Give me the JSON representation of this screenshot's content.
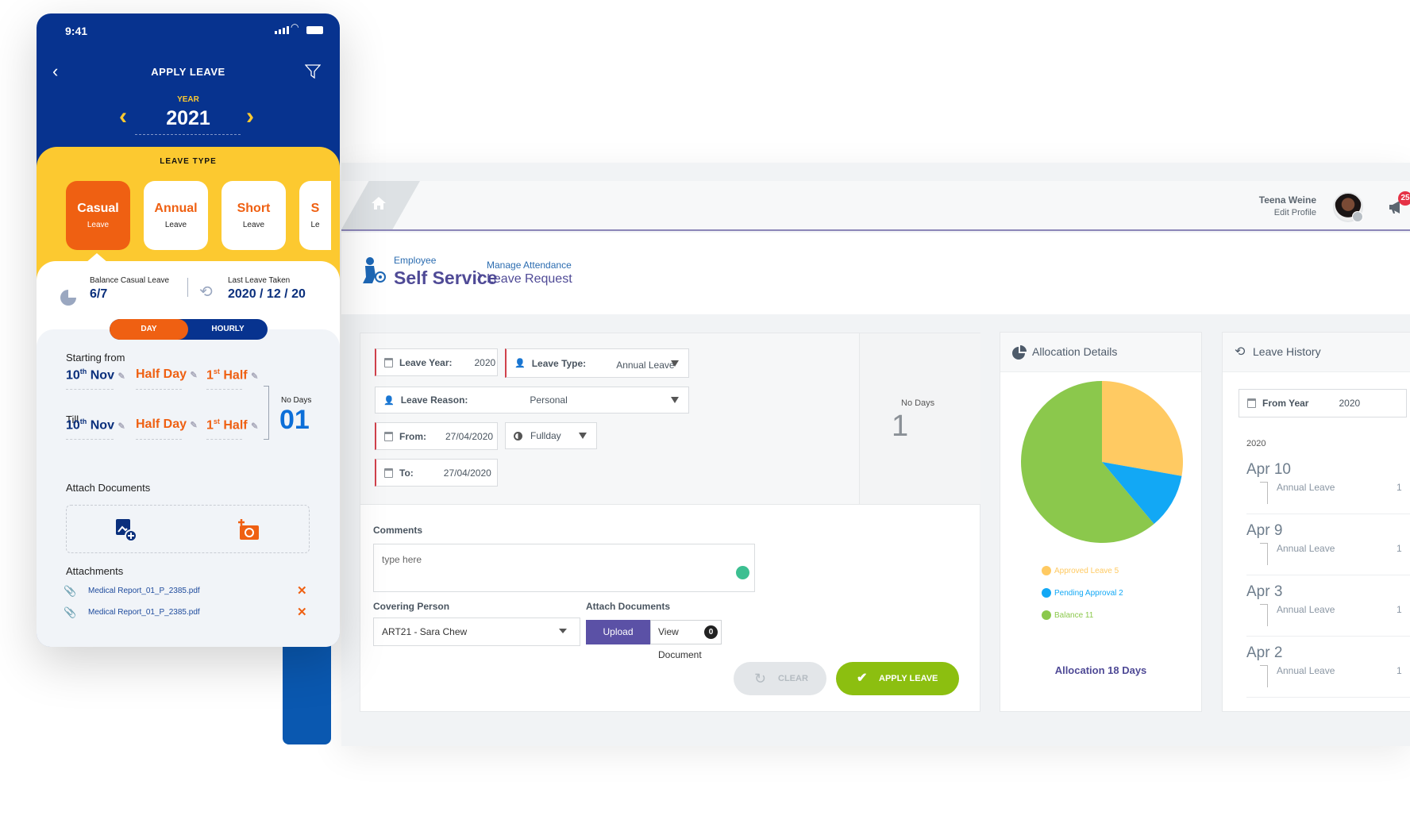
{
  "mobile": {
    "status_time": "9:41",
    "title": "APPLY LEAVE",
    "year_label": "YEAR",
    "year": "2021",
    "leave_type_label": "LEAVE TYPE",
    "leave_types": [
      {
        "name": "Casual",
        "sub": "Leave",
        "selected": true
      },
      {
        "name": "Annual",
        "sub": "Leave"
      },
      {
        "name": "Short",
        "sub": "Leave"
      },
      {
        "name": "S",
        "sub": "Le"
      }
    ],
    "balance_label": "Balance Casual Leave",
    "balance_value": "6/7",
    "last_leave_label": "Last Leave Taken",
    "last_leave_value": "2020 / 12 / 20",
    "toggle": {
      "day": "DAY",
      "hourly": "HOURLY",
      "selected": "DAY"
    },
    "starting_from_label": "Starting from",
    "till_label": "Till",
    "start": {
      "day": "10",
      "day_suffix": "th",
      "month": "Nov",
      "type": "Half Day",
      "half": "1",
      "half_suffix": "st",
      "half_label": "Half"
    },
    "end": {
      "day": "10",
      "day_suffix": "th",
      "month": "Nov",
      "type": "Half Day",
      "half": "1",
      "half_suffix": "st",
      "half_label": "Half"
    },
    "no_days_label": "No Days",
    "no_days_value": "01",
    "attach_label": "Attach Documents",
    "attachments_label": "Attachments",
    "attachments": [
      "Medical Report_01_P_2385.pdf",
      "Medical Report_01_P_2385.pdf"
    ],
    "colors": {
      "blue": "#07338f",
      "yellow": "#fcc930",
      "orange": "#ef6012"
    }
  },
  "header": {
    "user_name": "Teena Weine",
    "edit_profile": "Edit Profile",
    "notification_count": "25"
  },
  "breadcrumb": {
    "module_small": "Employee",
    "module": "Self Service",
    "section_small": "Manage Attendance",
    "section": "Leave Request"
  },
  "form": {
    "leave_year_label": "Leave Year:",
    "leave_year": "2020",
    "leave_type_label": "Leave Type:",
    "leave_type": "Annual Leave",
    "leave_reason_label": "Leave Reason:",
    "leave_reason": "Personal",
    "from_label": "From:",
    "from": "27/04/2020",
    "day_type": "Fullday",
    "to_label": "To:",
    "to": "27/04/2020",
    "no_days_label": "No Days",
    "no_days": "1",
    "comments_label": "Comments",
    "comments_placeholder": "type here",
    "covering_label": "Covering Person",
    "covering_value": "ART21 - Sara Chew",
    "attach_label": "Attach Documents",
    "upload_label": "Upload Document",
    "view_label": "View Document",
    "view_count": "0",
    "clear_label": "CLEAR",
    "apply_label": "APPLY LEAVE"
  },
  "allocation": {
    "title": "Allocation Details",
    "footer": "Allocation 18 Days",
    "chart_data": {
      "type": "pie",
      "categories": [
        "Approved Leave",
        "Pending Approval",
        "Balance"
      ],
      "values": [
        5,
        2,
        11
      ],
      "colors": [
        "#ffca62",
        "#12a8f5",
        "#8bc84c"
      ],
      "legend": [
        "Approved Leave  5",
        "Pending Approval 2",
        "Balance  11"
      ]
    }
  },
  "history": {
    "title": "Leave History",
    "from_year_label": "From Year",
    "from_year": "2020",
    "year_heading": "2020",
    "items": [
      {
        "date": "Apr 10",
        "type": "Annual Leave",
        "days": "1"
      },
      {
        "date": "Apr 9",
        "type": "Annual Leave",
        "days": "1"
      },
      {
        "date": "Apr 3",
        "type": "Annual Leave",
        "days": "1"
      },
      {
        "date": "Apr 2",
        "type": "Annual Leave",
        "days": "1"
      }
    ]
  }
}
